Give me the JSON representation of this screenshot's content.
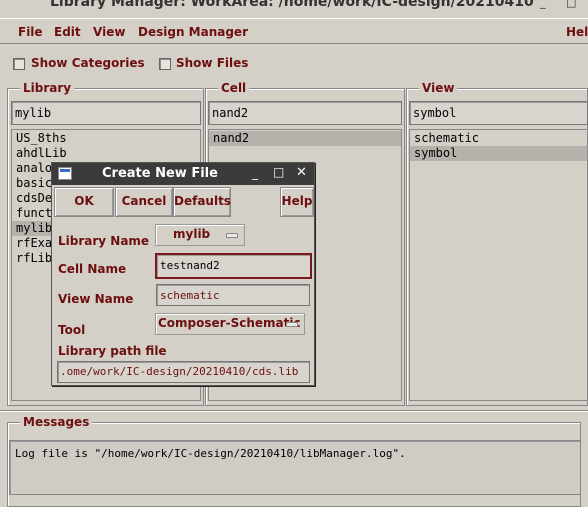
{
  "window": {
    "title": "Library Manager: WorkArea: /home/work/IC-design/20210410"
  },
  "menubar": {
    "file": "File",
    "edit": "Edit",
    "view": "View",
    "design_manager": "Design Manager",
    "help": "Help"
  },
  "options": {
    "show_categories": "Show Categories",
    "show_files": "Show Files"
  },
  "library": {
    "title": "Library",
    "filter": "mylib",
    "items": [
      "US_8ths",
      "ahdlLib",
      "analo",
      "basic",
      "cdsDe",
      "functi",
      "mylib",
      "rfExam",
      "rfLib"
    ],
    "selected_index": 6
  },
  "cell": {
    "title": "Cell",
    "filter": "nand2",
    "items": [
      "nand2"
    ],
    "selected_index": 0
  },
  "view": {
    "title": "View",
    "filter": "symbol",
    "items": [
      "schematic",
      "symbol"
    ],
    "selected_index": 1
  },
  "dialog": {
    "title": "Create New File",
    "ok": "OK",
    "cancel": "Cancel",
    "defaults": "Defaults",
    "help": "Help",
    "library_name_label": "Library Name",
    "library_name_value": "mylib",
    "cell_name_label": "Cell Name",
    "cell_name_value": "testnand2",
    "view_name_label": "View Name",
    "view_name_value": "schematic",
    "tool_label": "Tool",
    "tool_value": "Composer-Schematic",
    "library_path_label": "Library path file",
    "library_path_value": ".ome/work/IC-design/20210410/cds.lib"
  },
  "messages": {
    "title": "Messages",
    "log": "Log file is \"/home/work/IC-design/20210410/libManager.log\"."
  },
  "colors": {
    "label_red": "#6e0f0f",
    "titlebar_dark": "#3b3b3b",
    "background": "#d4d0c8"
  }
}
